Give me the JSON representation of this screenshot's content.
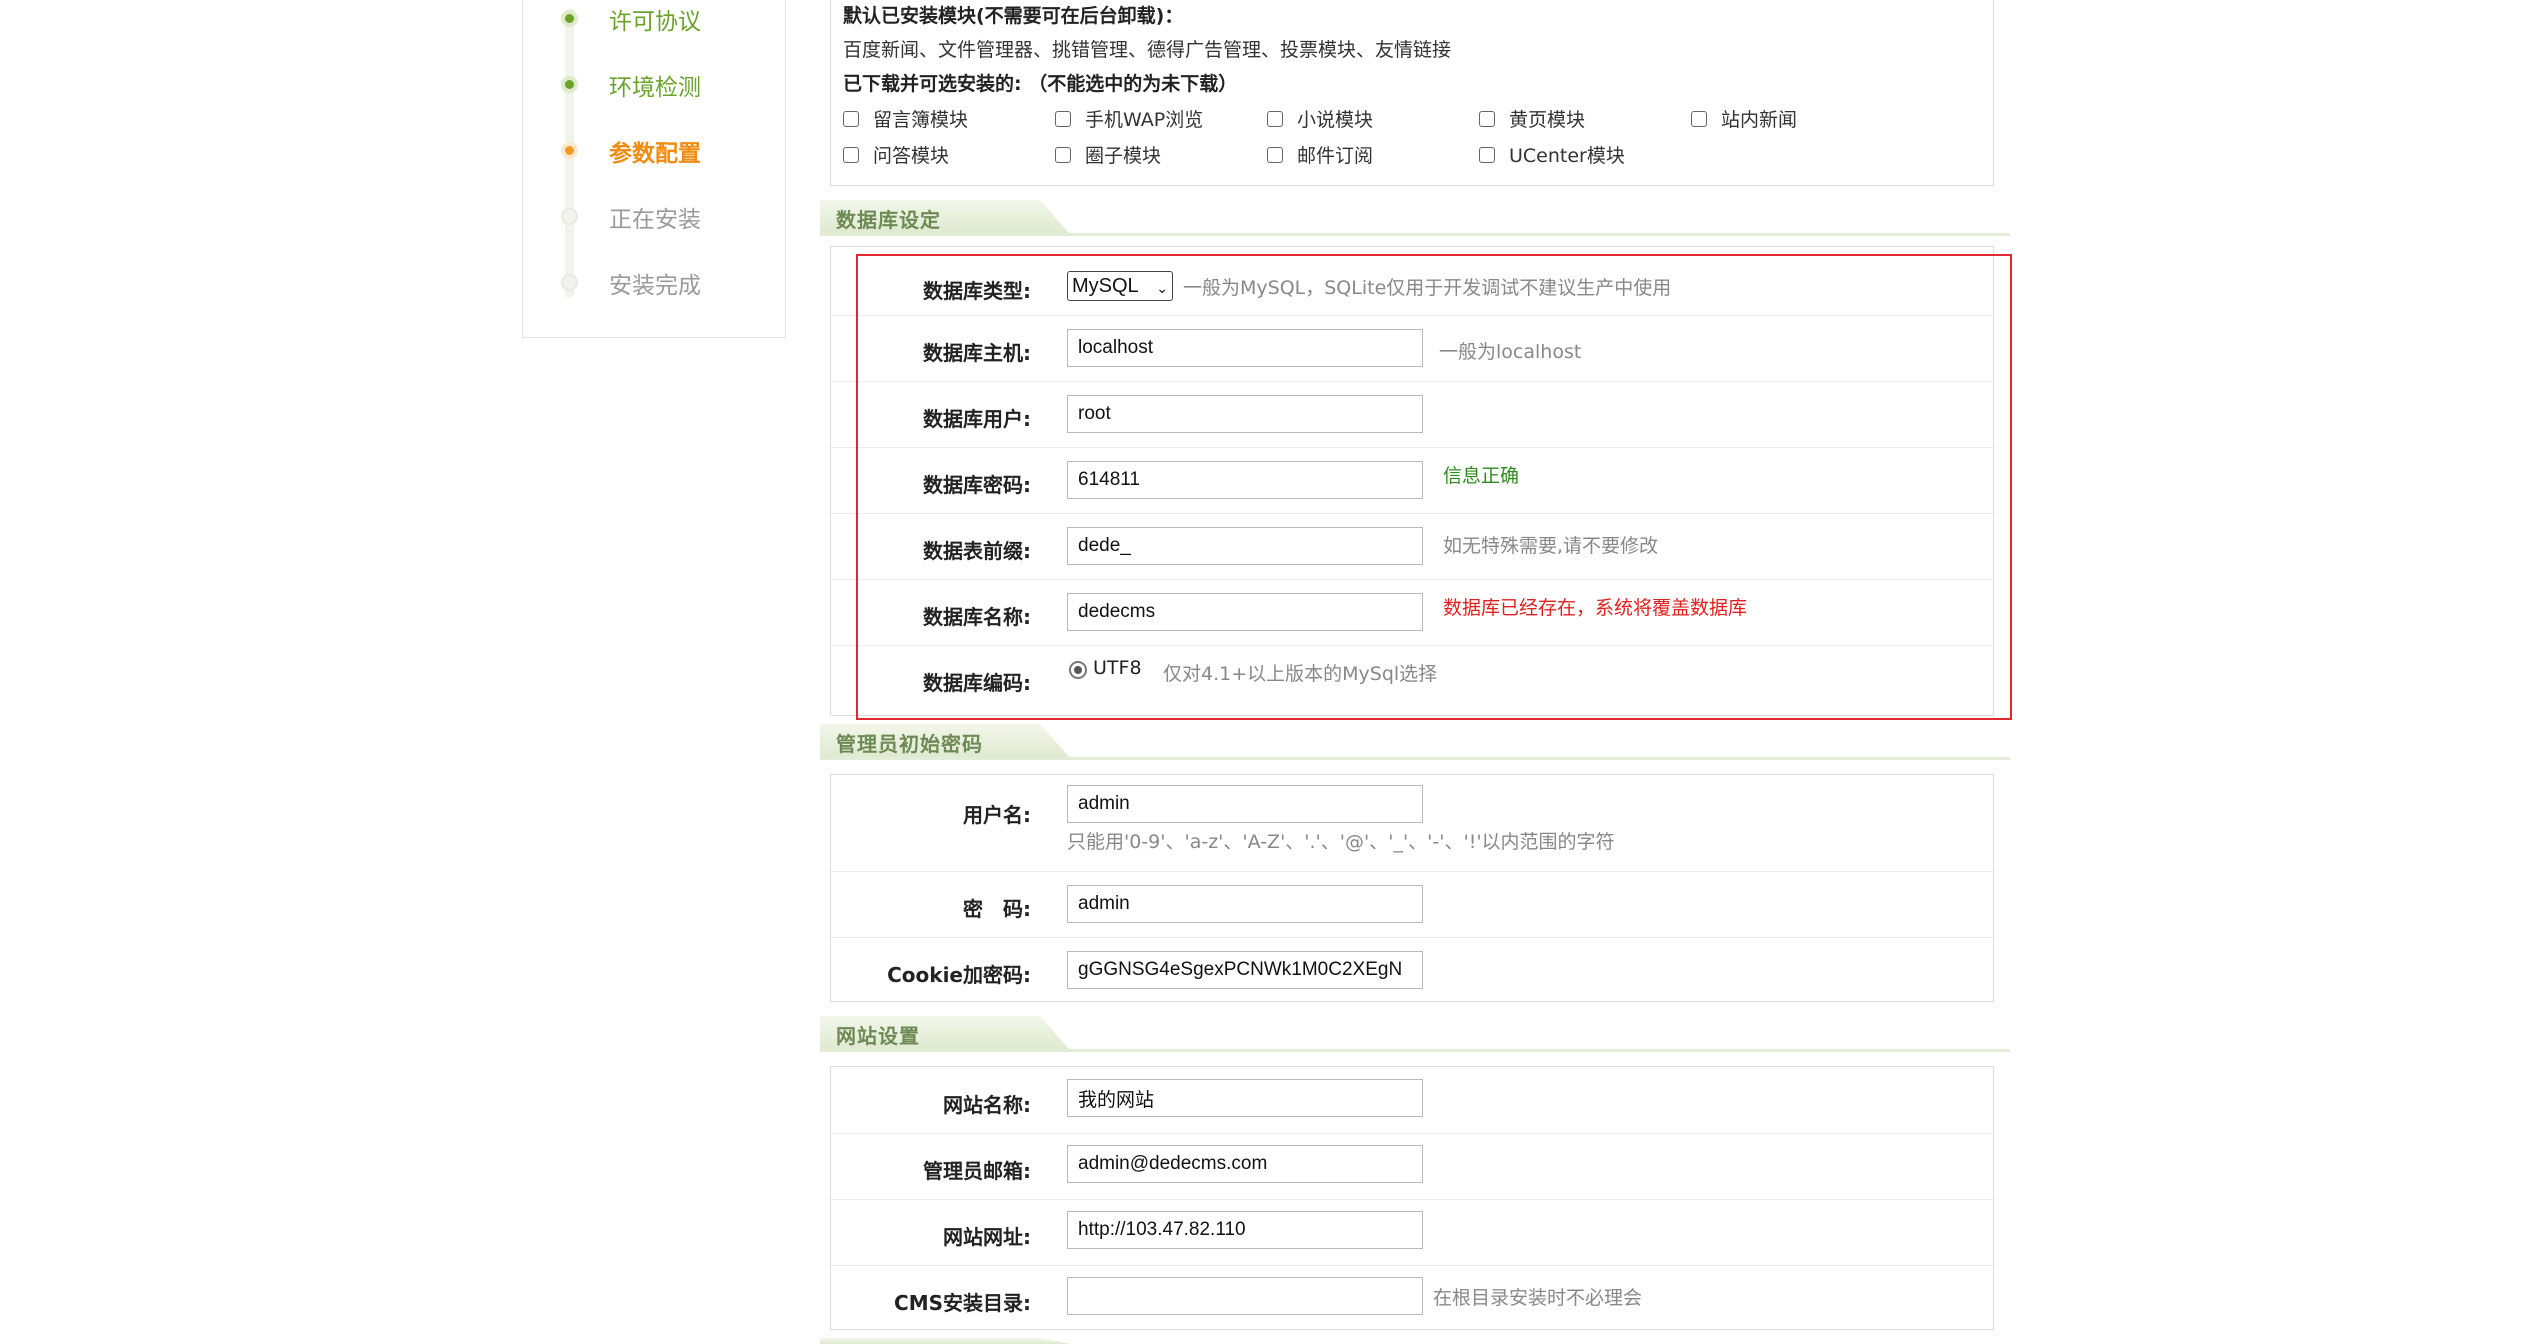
{
  "steps": [
    {
      "label": "许可协议",
      "state": "done"
    },
    {
      "label": "环境检测",
      "state": "done"
    },
    {
      "label": "参数配置",
      "state": "current"
    },
    {
      "label": "正在安装",
      "state": "todo"
    },
    {
      "label": "安装完成",
      "state": "todo"
    }
  ],
  "modules": {
    "installed_title": "默认已安装模块(不需要可在后台卸载)：",
    "installed_list": "百度新闻、文件管理器、挑错管理、德得广告管理、投票模块、友情链接",
    "optional_title": "已下载并可选安装的: （不能选中的为未下载）",
    "optional": [
      "留言簿模块",
      "手机WAP浏览",
      "小说模块",
      "黄页模块",
      "站内新闻",
      "问答模块",
      "圈子模块",
      "邮件订阅",
      "UCenter模块"
    ]
  },
  "db": {
    "section_title": "数据库设定",
    "type_label": "数据库类型:",
    "type_value": "MySQL",
    "type_hint": "一般为MySQL，SQLite仅用于开发调试不建议生产中使用",
    "host_label": "数据库主机:",
    "host_value": "localhost",
    "host_hint": "一般为localhost",
    "user_label": "数据库用户:",
    "user_value": "root",
    "pwd_label": "数据库密码:",
    "pwd_value": "614811",
    "pwd_hint": "信息正确",
    "prefix_label": "数据表前缀:",
    "prefix_value": "dede_",
    "prefix_hint": "如无特殊需要,请不要修改",
    "name_label": "数据库名称:",
    "name_value": "dedecms",
    "name_hint": "数据库已经存在，系统将覆盖数据库",
    "charset_label": "数据库编码:",
    "charset_value": "UTF8",
    "charset_hint": "仅对4.1+以上版本的MySql选择"
  },
  "admin": {
    "section_title": "管理员初始密码",
    "user_label": "用户名:",
    "user_value": "admin",
    "user_hint": "只能用'0-9'、'a-z'、'A-Z'、'.'、'@'、'_'、'-'、'!'以内范围的字符",
    "pwd_label": "密　码:",
    "pwd_value": "admin",
    "cookie_label": "Cookie加密码:",
    "cookie_value": "gGGNSG4eSgexPCNWk1M0C2XEgN"
  },
  "site": {
    "section_title": "网站设置",
    "name_label": "网站名称:",
    "name_value": "我的网站",
    "email_label": "管理员邮箱:",
    "email_value": "admin@dedecms.com",
    "url_label": "网站网址:",
    "url_value": "http://103.47.82.110",
    "dir_label": "CMS安装目录:",
    "dir_value": "",
    "dir_hint": "在根目录安装时不必理会"
  }
}
